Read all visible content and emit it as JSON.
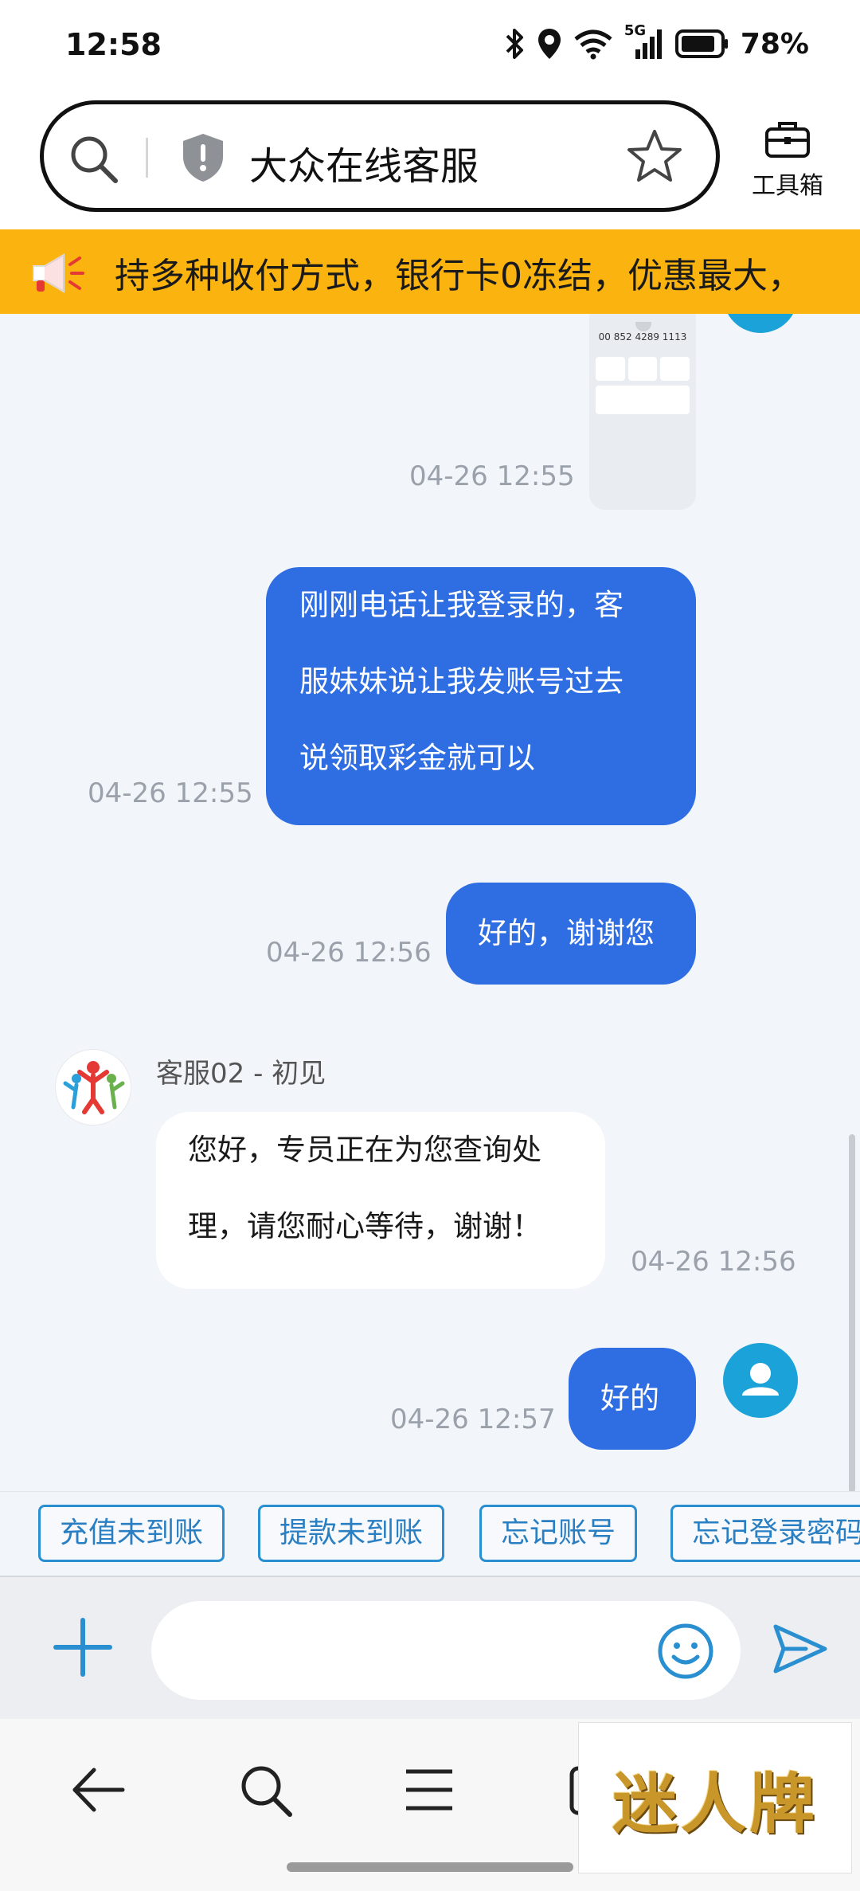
{
  "status_bar": {
    "time": "12:58",
    "network": "5G",
    "battery": "78%",
    "icons": [
      "bluetooth-icon",
      "location-icon",
      "wifi-icon",
      "signal-icon",
      "battery-icon"
    ]
  },
  "address_bar": {
    "title": "大众在线客服",
    "toolbox_label": "工具箱",
    "icons": [
      "search-icon",
      "shield-icon",
      "star-icon",
      "toolbox-icon"
    ]
  },
  "notice": {
    "text": "持多种收付方式，银行卡0冻结，优惠最大，",
    "icon": "megaphone-icon"
  },
  "shared_image": {
    "phone": "00 852 4289 1113",
    "timestamp": "04-26 12:55"
  },
  "messages": [
    {
      "direction": "out",
      "lines": [
        "刚刚电话让我登录的，客",
        "服妹妹说让我发账号过去",
        "说领取彩金就可以"
      ],
      "timestamp": "04-26 12:55"
    },
    {
      "direction": "out",
      "lines": [
        "好的，谢谢您"
      ],
      "timestamp": "04-26 12:56"
    },
    {
      "direction": "in",
      "sender": "客服02 - 初见",
      "lines": [
        "您好，专员正在为您查询处",
        "理，请您耐心等待，谢谢！"
      ],
      "timestamp": "04-26 12:56"
    },
    {
      "direction": "out",
      "lines": [
        "好的"
      ],
      "timestamp": "04-26 12:57"
    }
  ],
  "quick_replies": [
    "充值未到账",
    "提款未到账",
    "忘记账号",
    "忘记登录密码"
  ],
  "input": {
    "value": "",
    "placeholder": ""
  },
  "nav_icons": [
    "back-arrow-icon",
    "search-icon",
    "menu-icon",
    "tabs-icon"
  ],
  "watermark": "迷人牌",
  "colors": {
    "bubble_out": "#2e6de2",
    "bubble_in": "#ffffff",
    "notice_bg": "#fbb40f",
    "accent": "#2a8fd0"
  }
}
